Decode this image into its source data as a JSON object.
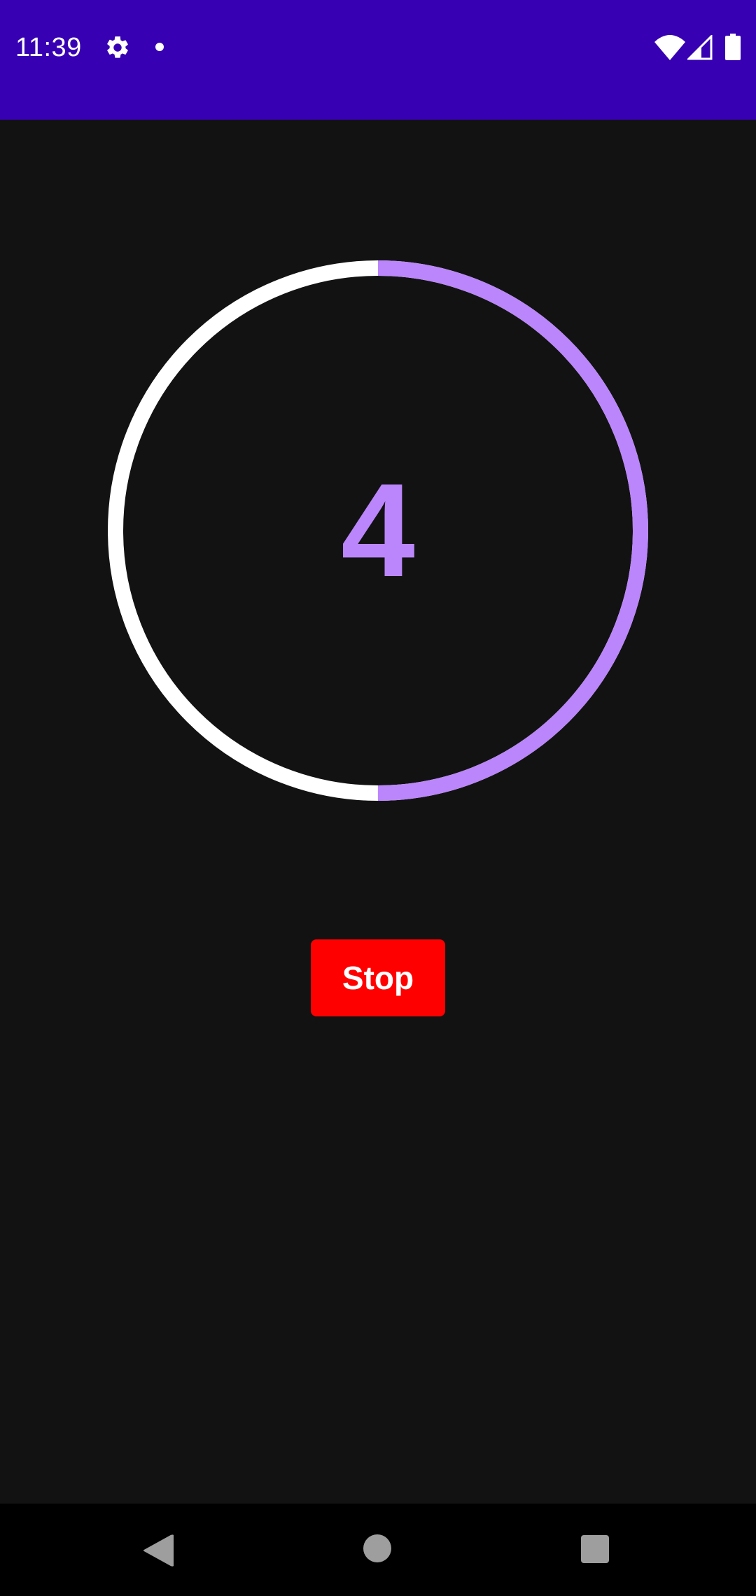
{
  "status_bar": {
    "time": "11:39",
    "background": "#3700b3",
    "icons": [
      "gear-icon",
      "notification-dot-icon",
      "wifi-icon",
      "cell-signal-icon",
      "battery-icon"
    ]
  },
  "timer": {
    "value": "4",
    "progress_fraction": 0.5,
    "progress_color": "#bb86fc",
    "track_color": "#ffffff"
  },
  "controls": {
    "stop_label": "Stop",
    "stop_color": "#ff0000"
  },
  "nav_bar": {
    "buttons": [
      "back-icon",
      "home-icon",
      "recents-icon"
    ]
  },
  "colors": {
    "background": "#121212"
  }
}
